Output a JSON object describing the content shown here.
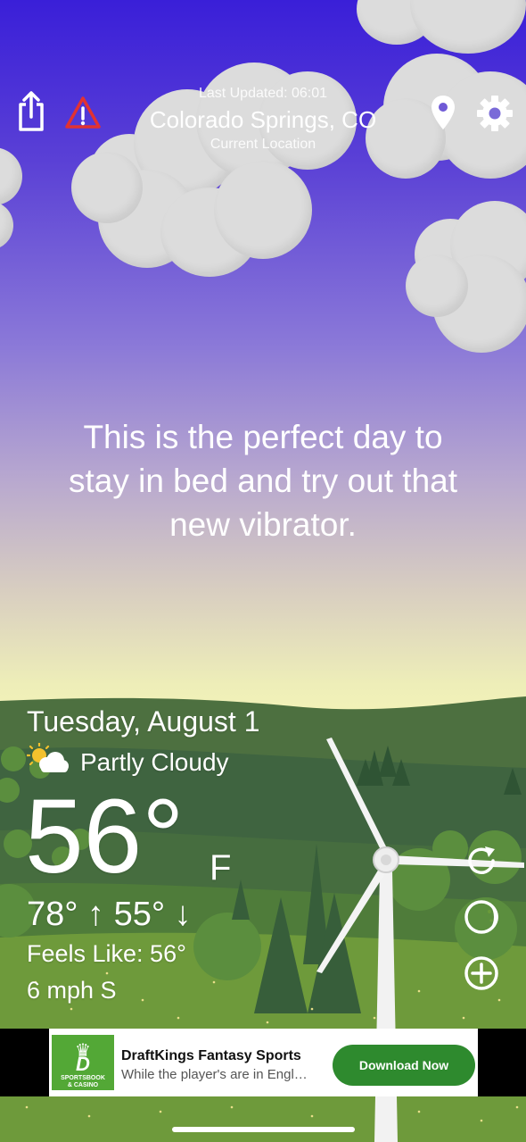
{
  "header": {
    "last_updated": "Last Updated: 06:01",
    "city": "Colorado Springs, CO",
    "location_label": "Current Location"
  },
  "icons": {
    "share": "share-icon",
    "alert": "warning-icon",
    "location": "location-pin-icon",
    "settings": "gear-icon"
  },
  "message": {
    "line1": "This is the perfect day to",
    "line2": "stay in bed and try out that",
    "line3": "new vibrator."
  },
  "weather": {
    "date": "Tuesday, August 1",
    "condition": "Partly Cloudy",
    "temperature": "56°",
    "unit": "F",
    "high": "78°",
    "low": "55°",
    "feels_like": "Feels Like: 56°",
    "wind": "6 mph S"
  },
  "side_buttons": [
    "refresh-icon",
    "moon-phase-icon",
    "add-icon"
  ],
  "ad": {
    "logo_text_line1": "SPORTSBOOK",
    "logo_text_line2": "& CASINO",
    "title": "DraftKings Fantasy Sports",
    "subtitle": "While the player's are in Engl…",
    "cta": "Download Now"
  },
  "colors": {
    "sky_top": "#3a1fd8",
    "horizon": "#f8f8b6",
    "grass": "#6f9a3a",
    "ad_button": "#2e8a2e",
    "ad_logo": "#53a836"
  }
}
